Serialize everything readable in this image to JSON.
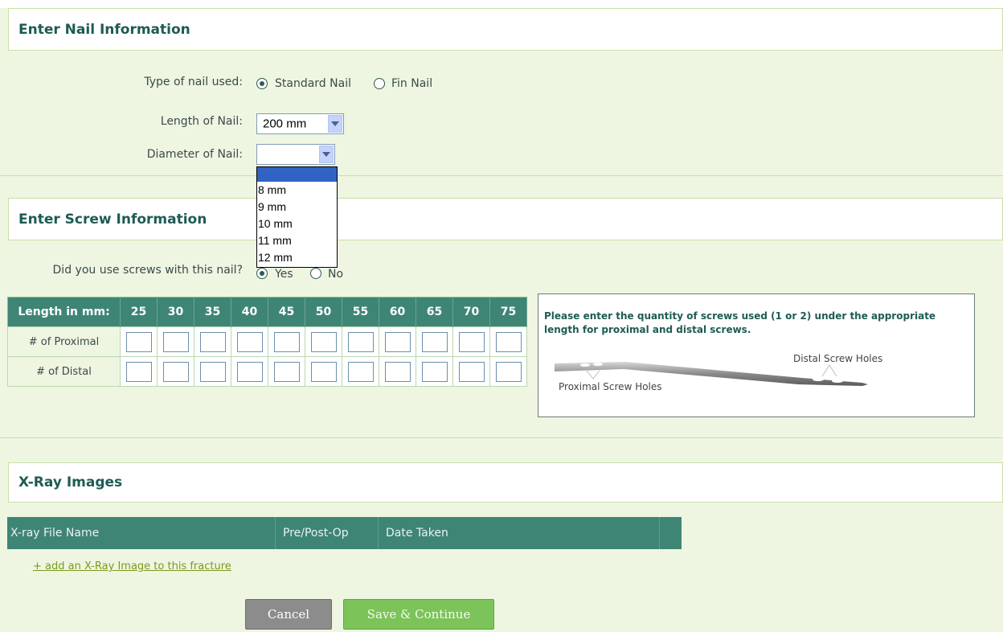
{
  "nail": {
    "section_title": "Enter Nail Information",
    "type_label": "Type of nail used:",
    "type_options": [
      "Standard Nail",
      "Fin Nail"
    ],
    "type_selected": "Standard Nail",
    "length_label": "Length of Nail:",
    "length_value": "200 mm",
    "diameter_label": "Diameter of Nail:",
    "diameter_value": "",
    "diameter_options": [
      "",
      "8 mm",
      "9 mm",
      "10 mm",
      "11 mm",
      "12 mm"
    ]
  },
  "screw": {
    "section_title": "Enter Screw Information",
    "question": "Did you use screws with this nail?",
    "yes_label": "Yes",
    "no_label": "No",
    "selected": "Yes",
    "table_header": "Length in mm:",
    "lengths": [
      "25",
      "30",
      "35",
      "40",
      "45",
      "50",
      "55",
      "60",
      "65",
      "70",
      "75"
    ],
    "rows": [
      "# of Proximal",
      "# of Distal"
    ],
    "instructions": "Please enter the quantity of screws used (1 or 2) under the appropriate length for proximal and distal screws.",
    "diagram_proximal": "Proximal Screw Holes",
    "diagram_distal": "Distal Screw Holes"
  },
  "xray": {
    "section_title": "X-Ray Images",
    "columns": [
      "X-ray File Name",
      "Pre/Post-Op",
      "Date Taken"
    ],
    "add_link": "+ add an X-Ray Image to this fracture"
  },
  "actions": {
    "cancel": "Cancel",
    "save": "Save & Continue"
  },
  "colors": {
    "panel_bg": "#eef6e2",
    "header_teal": "#3e8575",
    "title_text": "#1e5b55",
    "save_green": "#7cc35a",
    "cancel_gray": "#8c8c8c"
  }
}
